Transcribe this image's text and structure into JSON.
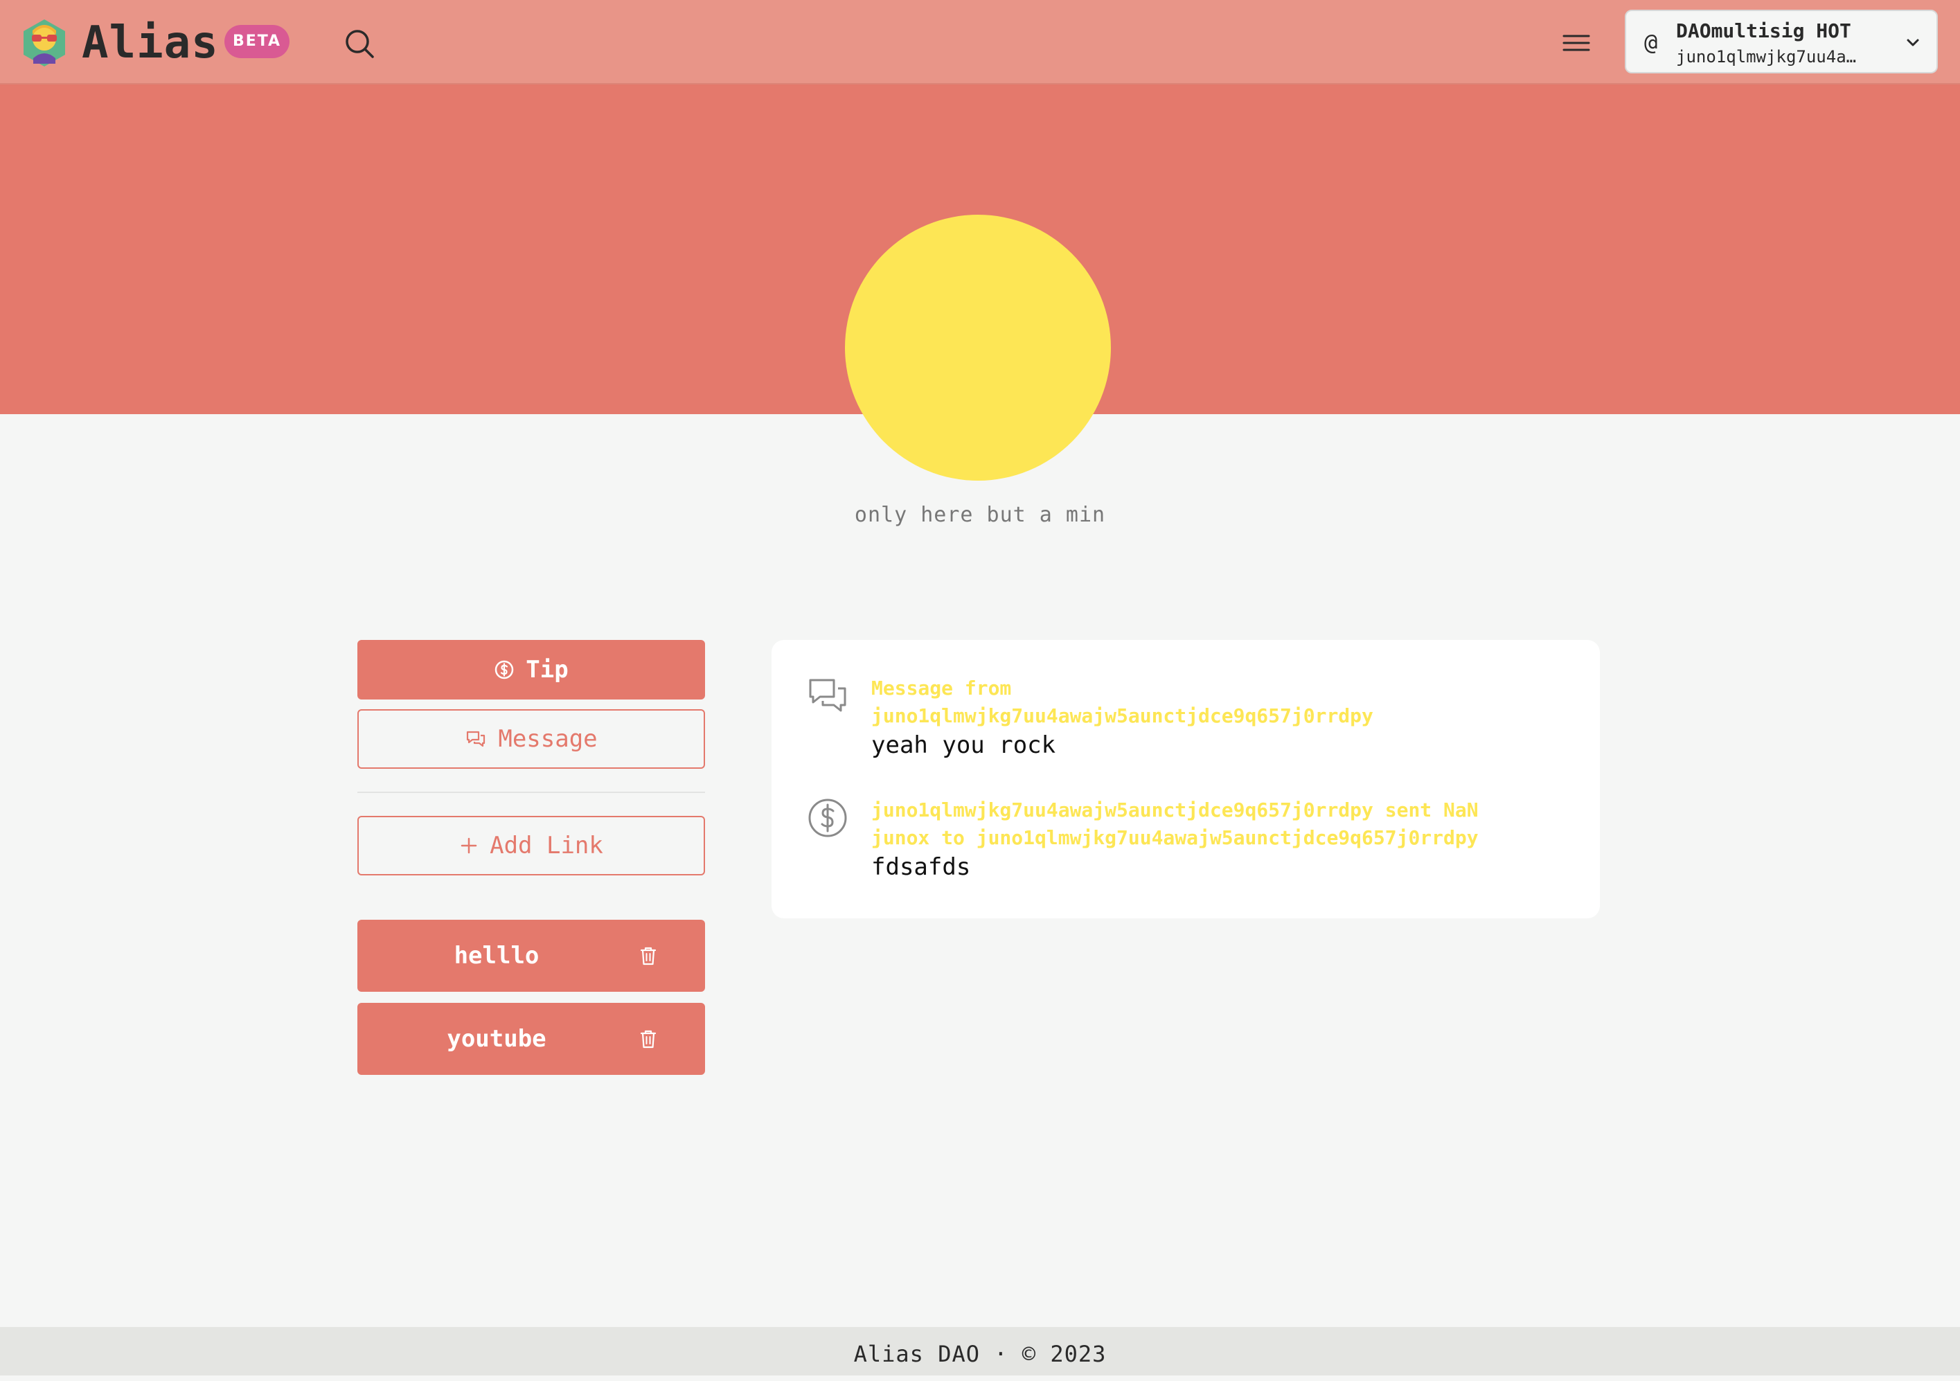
{
  "header": {
    "brand": "Alias",
    "badge": "BETA",
    "account": {
      "name": "DAOmultisig HOT",
      "address": "juno1qlmwjkg7uu4a…"
    }
  },
  "profile": {
    "bio": "only here but a min"
  },
  "actions": {
    "tip_label": "Tip",
    "message_label": "Message",
    "add_link_label": "Add Link"
  },
  "links": [
    {
      "label": "helllo"
    },
    {
      "label": "youtube"
    }
  ],
  "activity": [
    {
      "icon": "chat-bubbles-icon",
      "title_line1": "Message from",
      "title_line2": "juno1qlmwjkg7uu4awajw5aunctjdce9q657j0rrdpy",
      "body": "yeah you rock"
    },
    {
      "icon": "dollar-circle-icon",
      "title_line1": "juno1qlmwjkg7uu4awajw5aunctjdce9q657j0rrdpy sent NaN",
      "title_line2": "junox to juno1qlmwjkg7uu4awajw5aunctjdce9q657j0rrdpy",
      "body": "fdsafds"
    }
  ],
  "footer": {
    "text": "Alias DAO · © 2023"
  },
  "colors": {
    "header_bg": "#e89588",
    "accent": "#e4796c",
    "avatar": "#fde655",
    "beta_badge": "#d95a93",
    "page_bg": "#f5f6f5"
  }
}
